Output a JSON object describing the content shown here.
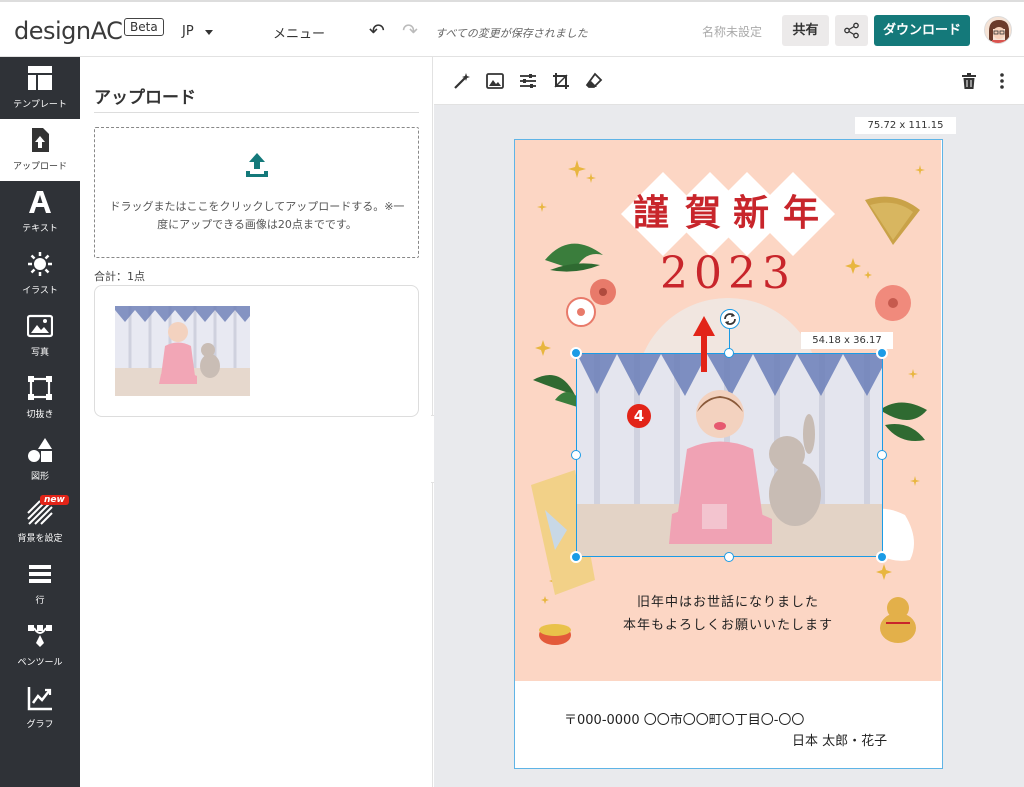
{
  "header": {
    "logo_text": "designAC",
    "beta_label": "Beta",
    "language": "JP",
    "menu_label": "メニュー",
    "saved_status": "すべての変更が保存されました",
    "untitled": "名称未設定",
    "share_label": "共有",
    "download_label": "ダウンロード"
  },
  "sidebar": {
    "items": [
      {
        "label": "テンプレート",
        "icon": "template-icon"
      },
      {
        "label": "アップロード",
        "icon": "upload-icon",
        "active": true
      },
      {
        "label": "テキスト",
        "icon": "text-icon"
      },
      {
        "label": "イラスト",
        "icon": "illustration-icon"
      },
      {
        "label": "写真",
        "icon": "photo-icon"
      },
      {
        "label": "切抜き",
        "icon": "crop-frame-icon"
      },
      {
        "label": "図形",
        "icon": "shapes-icon"
      },
      {
        "label": "背景を設定",
        "icon": "background-icon",
        "badge": "new"
      },
      {
        "label": "行",
        "icon": "rows-icon"
      },
      {
        "label": "ペンツール",
        "icon": "pen-tool-icon"
      },
      {
        "label": "グラフ",
        "icon": "graph-icon"
      }
    ]
  },
  "panel": {
    "title": "アップロード",
    "drop_text": "ドラッグまたはここをクリックしてアップロードする。※一度にアップできる画像は20点までです。",
    "total": "合計：1点"
  },
  "canvas": {
    "page_size": "75.72 x 111.15",
    "selection_size": "54.18 x 36.17",
    "card": {
      "title_chars": [
        "謹",
        "賀",
        "新",
        "年"
      ],
      "year": "2023",
      "greeting_line1": "旧年中はお世話になりました",
      "greeting_line2": "本年もよろしくお願いいたします",
      "address": "〒000-0000 〇〇市〇〇町〇丁目〇-〇〇",
      "names": "日本 太郎・花子",
      "step_badge": "4"
    }
  },
  "colors": {
    "accent": "#14797a",
    "sidebar_bg": "#2f3237",
    "card_bg": "#fcd6c4",
    "title_red": "#c8252b",
    "selection_blue": "#1a9be6",
    "arrow_red": "#e22418"
  }
}
